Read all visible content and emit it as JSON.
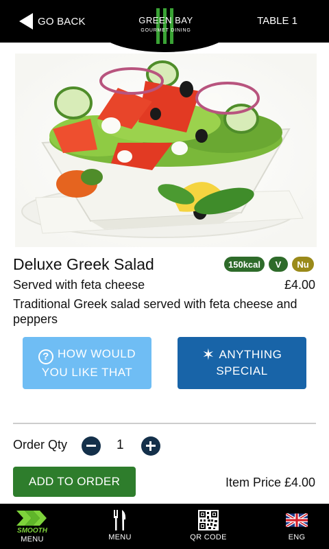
{
  "header": {
    "back_label": "GO BACK",
    "table_label": "TABLE 1",
    "logo_top": "GREEN BAY",
    "logo_bottom": "GOURMET DINING"
  },
  "item": {
    "name": "Deluxe Greek Salad",
    "subtitle": "Served with feta cheese",
    "price": "£4.00",
    "description": "Traditional Greek salad served with feta cheese and peppers",
    "badges": [
      {
        "label": "150kcal",
        "color": "#2e6b2a"
      },
      {
        "label": "V",
        "color": "#2e6b2a"
      },
      {
        "label": "Nu",
        "color": "#9a8a1a"
      }
    ]
  },
  "options": {
    "how_label": "HOW WOULD YOU LIKE THAT",
    "special_label": "ANYTHING SPECIAL"
  },
  "order": {
    "qty_label": "Order Qty",
    "qty_value": "1",
    "add_label": "ADD TO ORDER",
    "item_price_label": "Item Price £4.00"
  },
  "nav": {
    "smooth_brand": "SMOOTH",
    "smooth_label": "MENU",
    "menu_label": "MENU",
    "qr_label": "QR CODE",
    "lang_label": "ENG"
  },
  "colors": {
    "accent_green": "#2e7d2c",
    "light_blue": "#6fbdf4",
    "dark_blue": "#1864a8",
    "qty_button": "#14304a"
  }
}
